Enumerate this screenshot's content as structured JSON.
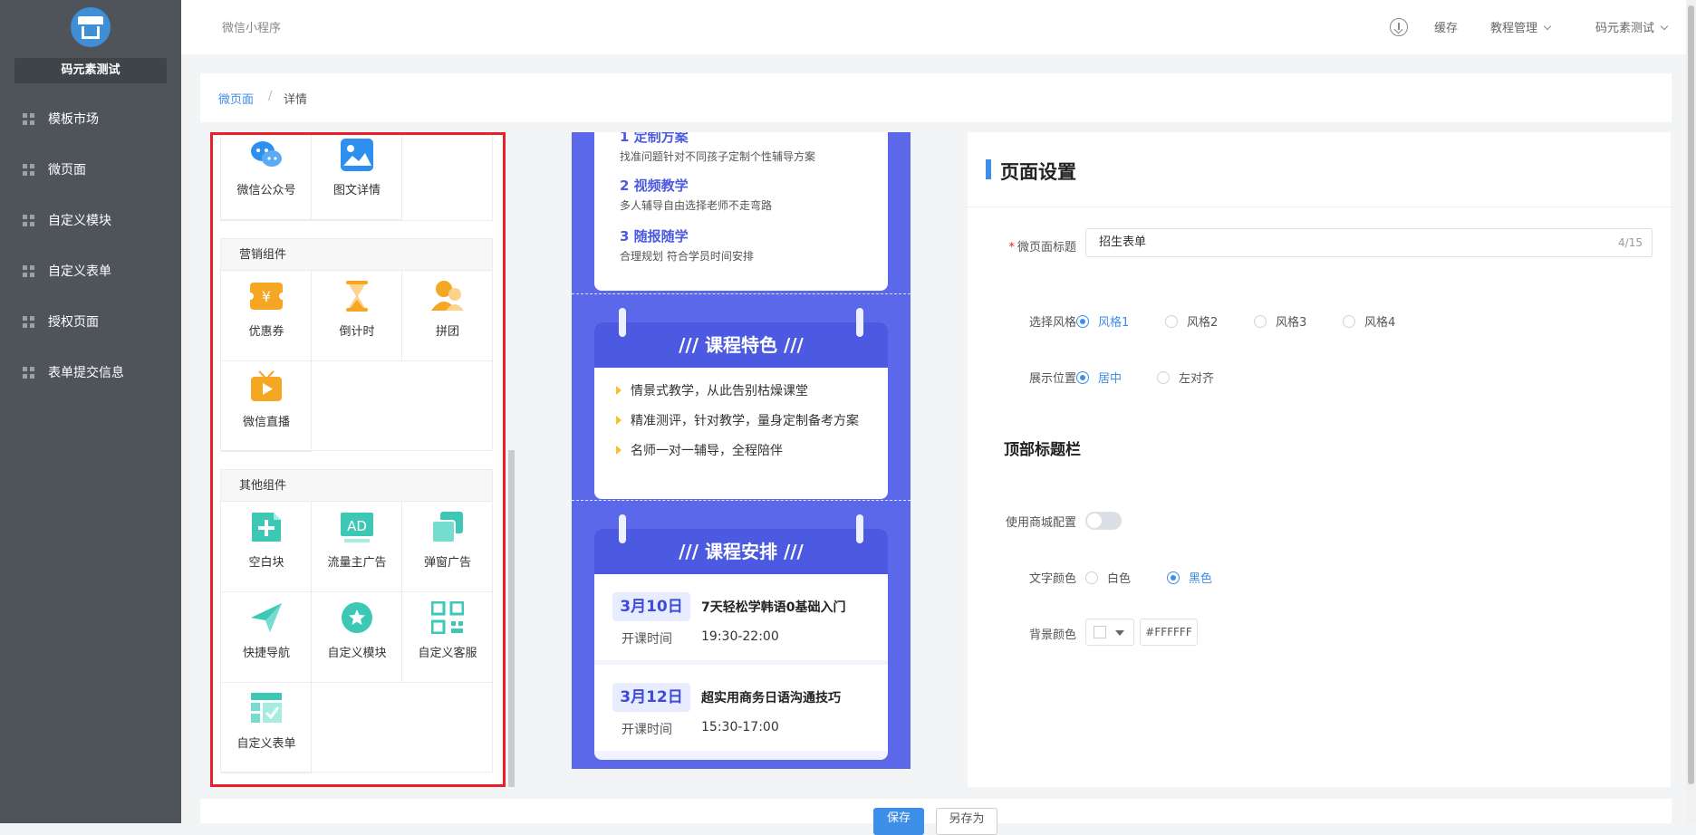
{
  "sidebar": {
    "store_name": "码元素测试",
    "items": [
      {
        "label": "模板市场"
      },
      {
        "label": "微页面"
      },
      {
        "label": "自定义模块"
      },
      {
        "label": "自定义表单"
      },
      {
        "label": "授权页面"
      },
      {
        "label": "表单提交信息"
      }
    ]
  },
  "header": {
    "app_name": "微信小程序",
    "cache": "缓存",
    "tutorial": "教程管理",
    "user": "码元素测试"
  },
  "breadcrumb": {
    "parent": "微页面",
    "sep": "/",
    "current": "详情"
  },
  "components": {
    "top_items": [
      {
        "label": "微信公众号",
        "icon": "wechat-icon",
        "color": "#2f8ff0"
      },
      {
        "label": "图文详情",
        "icon": "image-icon",
        "color": "#2f8ff0"
      }
    ],
    "marketing": {
      "title": "营销组件",
      "items": [
        {
          "label": "优惠券",
          "icon": "coupon-icon",
          "color": "#f5a623"
        },
        {
          "label": "倒计时",
          "icon": "hourglass-icon",
          "color": "#f5a623"
        },
        {
          "label": "拼团",
          "icon": "group-buy-icon",
          "color": "#f5a623"
        },
        {
          "label": "微信直播",
          "icon": "live-icon",
          "color": "#f5a623"
        }
      ]
    },
    "other": {
      "title": "其他组件",
      "items": [
        {
          "label": "空白块",
          "icon": "blank-block-icon",
          "color": "#3cc8b4"
        },
        {
          "label": "流量主广告",
          "icon": "ad-icon",
          "color": "#3cc8b4"
        },
        {
          "label": "弹窗广告",
          "icon": "popup-icon",
          "color": "#3cc8b4"
        },
        {
          "label": "快捷导航",
          "icon": "nav-plane-icon",
          "color": "#3cc8b4"
        },
        {
          "label": "自定义模块",
          "icon": "custom-module-icon",
          "color": "#3cc8b4"
        },
        {
          "label": "自定义客服",
          "icon": "qrcode-icon",
          "color": "#3cc8b4"
        },
        {
          "label": "自定义表单",
          "icon": "form-icon",
          "color": "#3cc8b4"
        }
      ]
    }
  },
  "preview": {
    "plan_steps": [
      {
        "title": "1 定制方案",
        "desc": "找准问题针对不同孩子定制个性辅导方案"
      },
      {
        "title": "2 视频教学",
        "desc": "多人辅导自由选择老师不走弯路"
      },
      {
        "title": "3 随报随学",
        "desc": "合理规划 符合学员时间安排"
      }
    ],
    "features": {
      "title": "/// 课程特色 ///",
      "items": [
        "情景式教学，从此告别枯燥课堂",
        "精准测评，针对教学，量身定制备考方案",
        "名师一对一辅导，全程陪伴"
      ]
    },
    "schedule": {
      "title": "/// 课程安排 ///",
      "items": [
        {
          "date": "3月10日",
          "course": "7天轻松学韩语0基础入门",
          "time_label": "开课时间",
          "time": "19:30-22:00"
        },
        {
          "date": "3月12日",
          "course": "超实用商务日语沟通技巧",
          "time_label": "开课时间",
          "time": "15:30-17:00"
        }
      ]
    }
  },
  "settings": {
    "title": "页面设置",
    "page_title_label": "微页面标题",
    "page_title_value": "招生表单",
    "page_title_count": "4/15",
    "style_label": "选择风格",
    "styles": [
      "风格1",
      "风格2",
      "风格3",
      "风格4"
    ],
    "position_label": "展示位置",
    "positions": [
      "居中",
      "左对齐"
    ],
    "topbar_title": "顶部标题栏",
    "use_mall_label": "使用商城配置",
    "text_color_label": "文字颜色",
    "text_colors": [
      "白色",
      "黑色"
    ],
    "bg_color_label": "背景颜色",
    "bg_color_value": "#FFFFFF"
  },
  "footer": {
    "save": "保存",
    "save_as": "另存为"
  },
  "theme": {
    "accent": "#3d8ee6",
    "sidebar": "#4e5459",
    "preview_bg": "#5c68ea",
    "highlight": "#e8202a"
  }
}
